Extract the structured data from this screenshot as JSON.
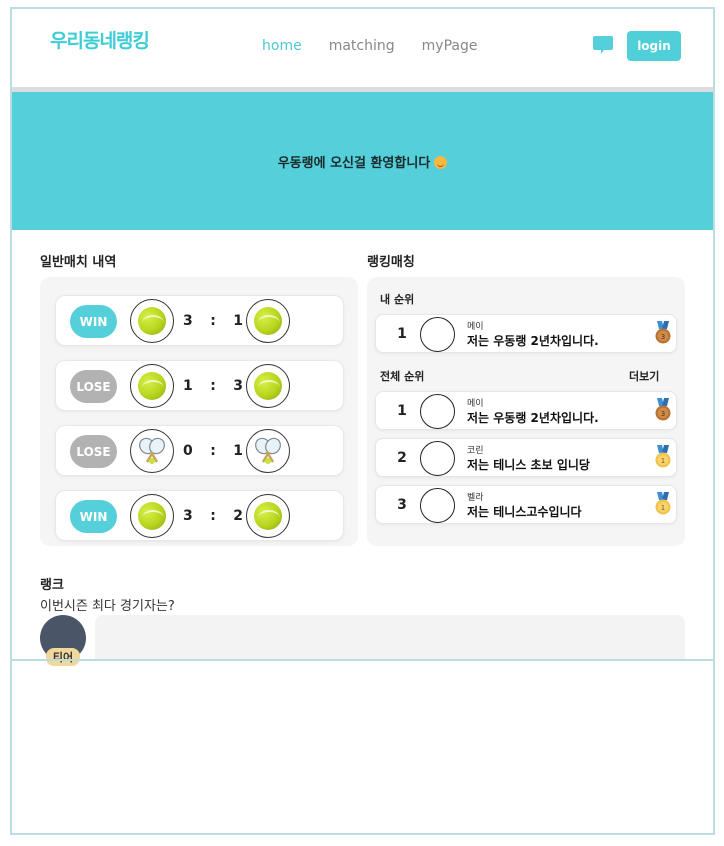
{
  "header": {
    "logo": "우리동네랭킹",
    "nav": [
      {
        "label": "home",
        "active": true
      },
      {
        "label": "matching",
        "active": false
      },
      {
        "label": "myPage",
        "active": false
      }
    ],
    "login_label": "login"
  },
  "hero": {
    "text": "우동랭에 오신걸 환영합니다"
  },
  "matches": {
    "title": "일반매치 내역",
    "items": [
      {
        "result": "WIN",
        "left": "3",
        "sep": ":",
        "right": "1",
        "icon": "tennis-ball-icon"
      },
      {
        "result": "LOSE",
        "left": "1",
        "sep": ":",
        "right": "3",
        "icon": "tennis-ball-icon"
      },
      {
        "result": "LOSE",
        "left": "0",
        "sep": ":",
        "right": "1",
        "icon": "tennis-racket-icon"
      },
      {
        "result": "WIN",
        "left": "3",
        "sep": ":",
        "right": "2",
        "icon": "tennis-ball-icon"
      }
    ]
  },
  "ranking": {
    "title": "랭킹매칭",
    "my_rank_label": "내 순위",
    "my_rank": {
      "rank": "1",
      "name": "메이",
      "intro": "저는 우동랭 2년차입니다.",
      "medal": "3"
    },
    "all_rank_label": "전체 순위",
    "more_label": "더보기",
    "all": [
      {
        "rank": "1",
        "name": "메이",
        "intro": "저는 우동랭 2년차입니다.",
        "medal": "3"
      },
      {
        "rank": "2",
        "name": "코린",
        "intro": "저는 테니스 초보 입니당",
        "medal": "1"
      },
      {
        "rank": "3",
        "name": "벨라",
        "intro": "저는 테니스고수입니다",
        "medal": "1"
      }
    ]
  },
  "rank_section": {
    "title": "랭크",
    "question": "이번시즌 최다 경기자는?",
    "tier_label": "티어"
  },
  "colors": {
    "accent": "#55cfd9",
    "lose": "#b2b2b2",
    "medal_bronze": "#b87333",
    "medal_gold": "#f2c14e",
    "ribbon": "#3f8fd8"
  }
}
